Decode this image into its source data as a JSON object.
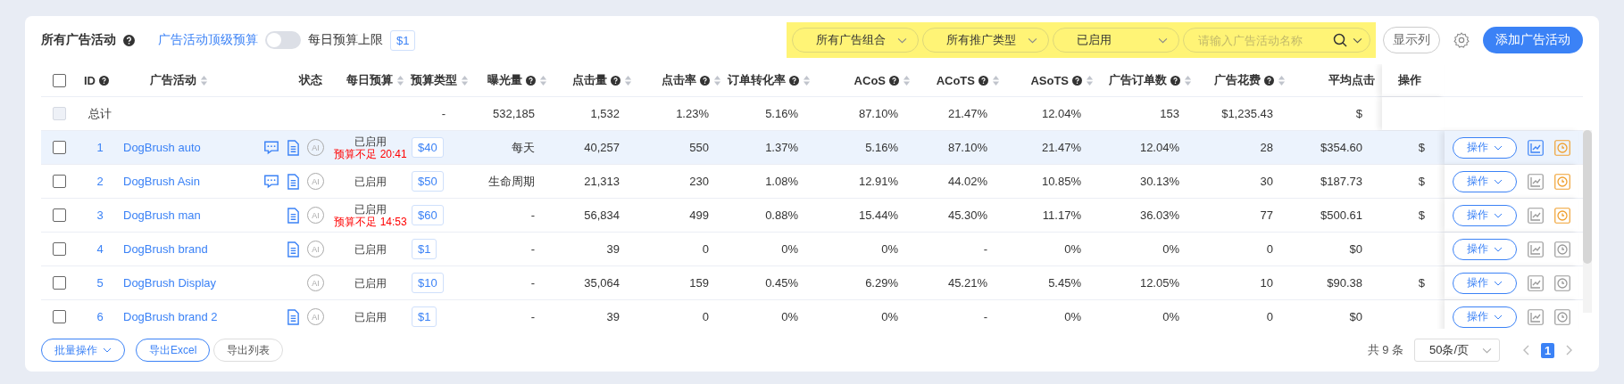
{
  "toolbar": {
    "title": "所有广告活动",
    "top_budget_label": "广告活动顶级预算",
    "top_budget_on": false,
    "daily_cap_label": "每日预算上限",
    "daily_cap_value": "$1"
  },
  "filters": [
    {
      "kind": "select",
      "label": "所有广告组合"
    },
    {
      "kind": "select",
      "label": "所有推广类型"
    },
    {
      "kind": "select",
      "label": "已启用"
    },
    {
      "kind": "search",
      "placeholder": "请输入广告活动名称"
    }
  ],
  "show_columns": "显示列",
  "add_button": "添加广告活动",
  "header_checkbox": {
    "checked": false
  },
  "columns": [
    {
      "label": "ID",
      "help": true,
      "sort": false
    },
    {
      "label": "广告活动",
      "help": false,
      "sort": true
    },
    {
      "label": "状态",
      "help": false,
      "sort": false
    },
    {
      "label": "每日预算",
      "help": false,
      "sort": true
    },
    {
      "label": "预算类型",
      "help": false,
      "sort": true
    },
    {
      "label": "曝光量",
      "help": true,
      "sort": true
    },
    {
      "label": "点击量",
      "help": true,
      "sort": true
    },
    {
      "label": "点击率",
      "help": true,
      "sort": true
    },
    {
      "label": "订单转化率",
      "help": true,
      "sort": true
    },
    {
      "label": "ACoS",
      "help": true,
      "sort": true
    },
    {
      "label": "ACoTS",
      "help": true,
      "sort": true
    },
    {
      "label": "ASoTS",
      "help": true,
      "sort": true
    },
    {
      "label": "广告订单数",
      "help": true,
      "sort": true
    },
    {
      "label": "广告花费",
      "help": true,
      "sort": true
    },
    {
      "label": "平均点击",
      "help": false,
      "sort": false
    }
  ],
  "ops_header": "操作",
  "totals": {
    "checkbox_disabled": true,
    "label": "总计",
    "budget_type": "-",
    "metrics": [
      "532,185",
      "1,532",
      "1.23%",
      "5.16%",
      "87.10%",
      "21.47%",
      "12.04%",
      "153",
      "$1,235.43"
    ],
    "avg": "$"
  },
  "rows": [
    {
      "id": "1",
      "name": "DogBrush auto",
      "selected": true,
      "checked": false,
      "icons": [
        {
          "kind": "chat"
        },
        {
          "kind": "document"
        }
      ],
      "ai": "AI",
      "status": "已启用",
      "warning": "预算不足 20:41",
      "budget": "$40",
      "budget_type": "每天",
      "metrics": [
        "40,257",
        "550",
        "1.37%",
        "5.16%",
        "87.10%",
        "21.47%",
        "12.04%",
        "28",
        "$354.60"
      ],
      "avg": "$",
      "ops": "操作",
      "chart_active": true,
      "clock_active": true
    },
    {
      "id": "2",
      "name": "DogBrush Asin",
      "selected": false,
      "checked": false,
      "icons": [
        {
          "kind": "chat"
        },
        {
          "kind": "document"
        }
      ],
      "ai": "AI",
      "status": "已启用",
      "budget": "$50",
      "budget_type": "生命周期",
      "metrics": [
        "21,313",
        "230",
        "1.08%",
        "12.91%",
        "44.02%",
        "10.85%",
        "30.13%",
        "30",
        "$187.73"
      ],
      "avg": "$",
      "ops": "操作",
      "chart_active": false,
      "clock_active": true
    },
    {
      "id": "3",
      "name": "DogBrush man",
      "selected": false,
      "checked": false,
      "icons": [
        {
          "kind": "document"
        }
      ],
      "ai": "AI",
      "status": "已启用",
      "warning": "预算不足 14:53",
      "budget": "$60",
      "budget_type": "-",
      "metrics": [
        "56,834",
        "499",
        "0.88%",
        "15.44%",
        "45.30%",
        "11.17%",
        "36.03%",
        "77",
        "$500.61"
      ],
      "avg": "$",
      "ops": "操作",
      "chart_active": false,
      "clock_active": true
    },
    {
      "id": "4",
      "name": "DogBrush brand",
      "selected": false,
      "checked": false,
      "icons": [
        {
          "kind": "document"
        }
      ],
      "ai": "AI",
      "status": "已启用",
      "budget": "$1",
      "budget_type": "-",
      "metrics": [
        "39",
        "0",
        "0%",
        "0%",
        "-",
        "0%",
        "0%",
        "0",
        "$0"
      ],
      "ops": "操作",
      "chart_active": false,
      "clock_active": false
    },
    {
      "id": "5",
      "name": "DogBrush Display",
      "selected": false,
      "checked": false,
      "ai": "AI",
      "status": "已启用",
      "budget": "$10",
      "budget_type": "-",
      "metrics": [
        "35,064",
        "159",
        "0.45%",
        "6.29%",
        "45.21%",
        "5.45%",
        "12.05%",
        "10",
        "$90.38"
      ],
      "avg": "$",
      "ops": "操作",
      "chart_active": false,
      "clock_active": false
    },
    {
      "id": "6",
      "name": "DogBrush brand 2",
      "selected": false,
      "checked": false,
      "icons": [
        {
          "kind": "document"
        }
      ],
      "ai": "AI",
      "status": "已启用",
      "budget": "$1",
      "budget_type": "-",
      "metrics": [
        "39",
        "0",
        "0%",
        "0%",
        "-",
        "0%",
        "0%",
        "0",
        "$0"
      ],
      "ops": "操作",
      "chart_active": false,
      "clock_active": false
    }
  ],
  "footer": {
    "batch": "批量操作",
    "export_excel": "导出Excel",
    "export_list": "导出列表",
    "total": "共 9 条",
    "page_size": "50条/页",
    "pages": [
      {
        "label": "1",
        "selected": true
      }
    ]
  }
}
